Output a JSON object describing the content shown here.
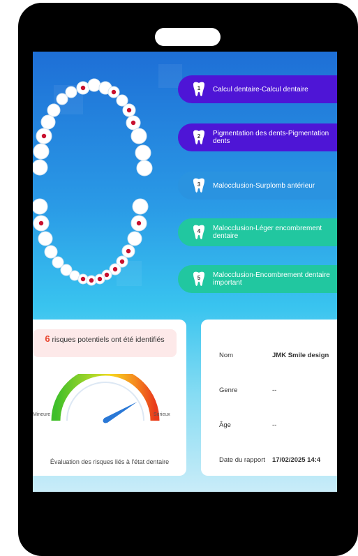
{
  "conditions": [
    {
      "number": "1",
      "label": "Calcul dentaire-Calcul dentaire",
      "color": "#4e15d6"
    },
    {
      "number": "2",
      "label": "Pigmentation des dents-Pigmentation dents",
      "color": "#4e15d6"
    },
    {
      "number": "3",
      "label": "Malocclusion-Surplomb antérieur",
      "color": "#2a93e0"
    },
    {
      "number": "4",
      "label": "Malocclusion-Léger encombrement dentaire",
      "color": "#21c7a0"
    },
    {
      "number": "5",
      "label": "Malocclusion-Encombrement dentaire important",
      "color": "#21c7a0"
    }
  ],
  "risk": {
    "count": "6",
    "text": "risques potentiels ont été identifiés",
    "gauge_min_label": "Mineure",
    "gauge_max_label": "Sérieux",
    "gauge_level": 0.83,
    "caption": "Évaluation des risques liés à l'état dentaire"
  },
  "patient": {
    "name_label": "Nom",
    "name_value": "JMK Smile design",
    "gender_label": "Genre",
    "gender_value": "--",
    "age_label": "Âge",
    "age_value": "--",
    "date_label": "Date du rapport",
    "date_value": "17/02/2025 14:4"
  },
  "colors": {
    "accent_purple": "#4e15d6",
    "accent_blue": "#2a93e0",
    "accent_green": "#21c7a0",
    "risk_red": "#e9462f",
    "marker_red": "#c8102e"
  }
}
